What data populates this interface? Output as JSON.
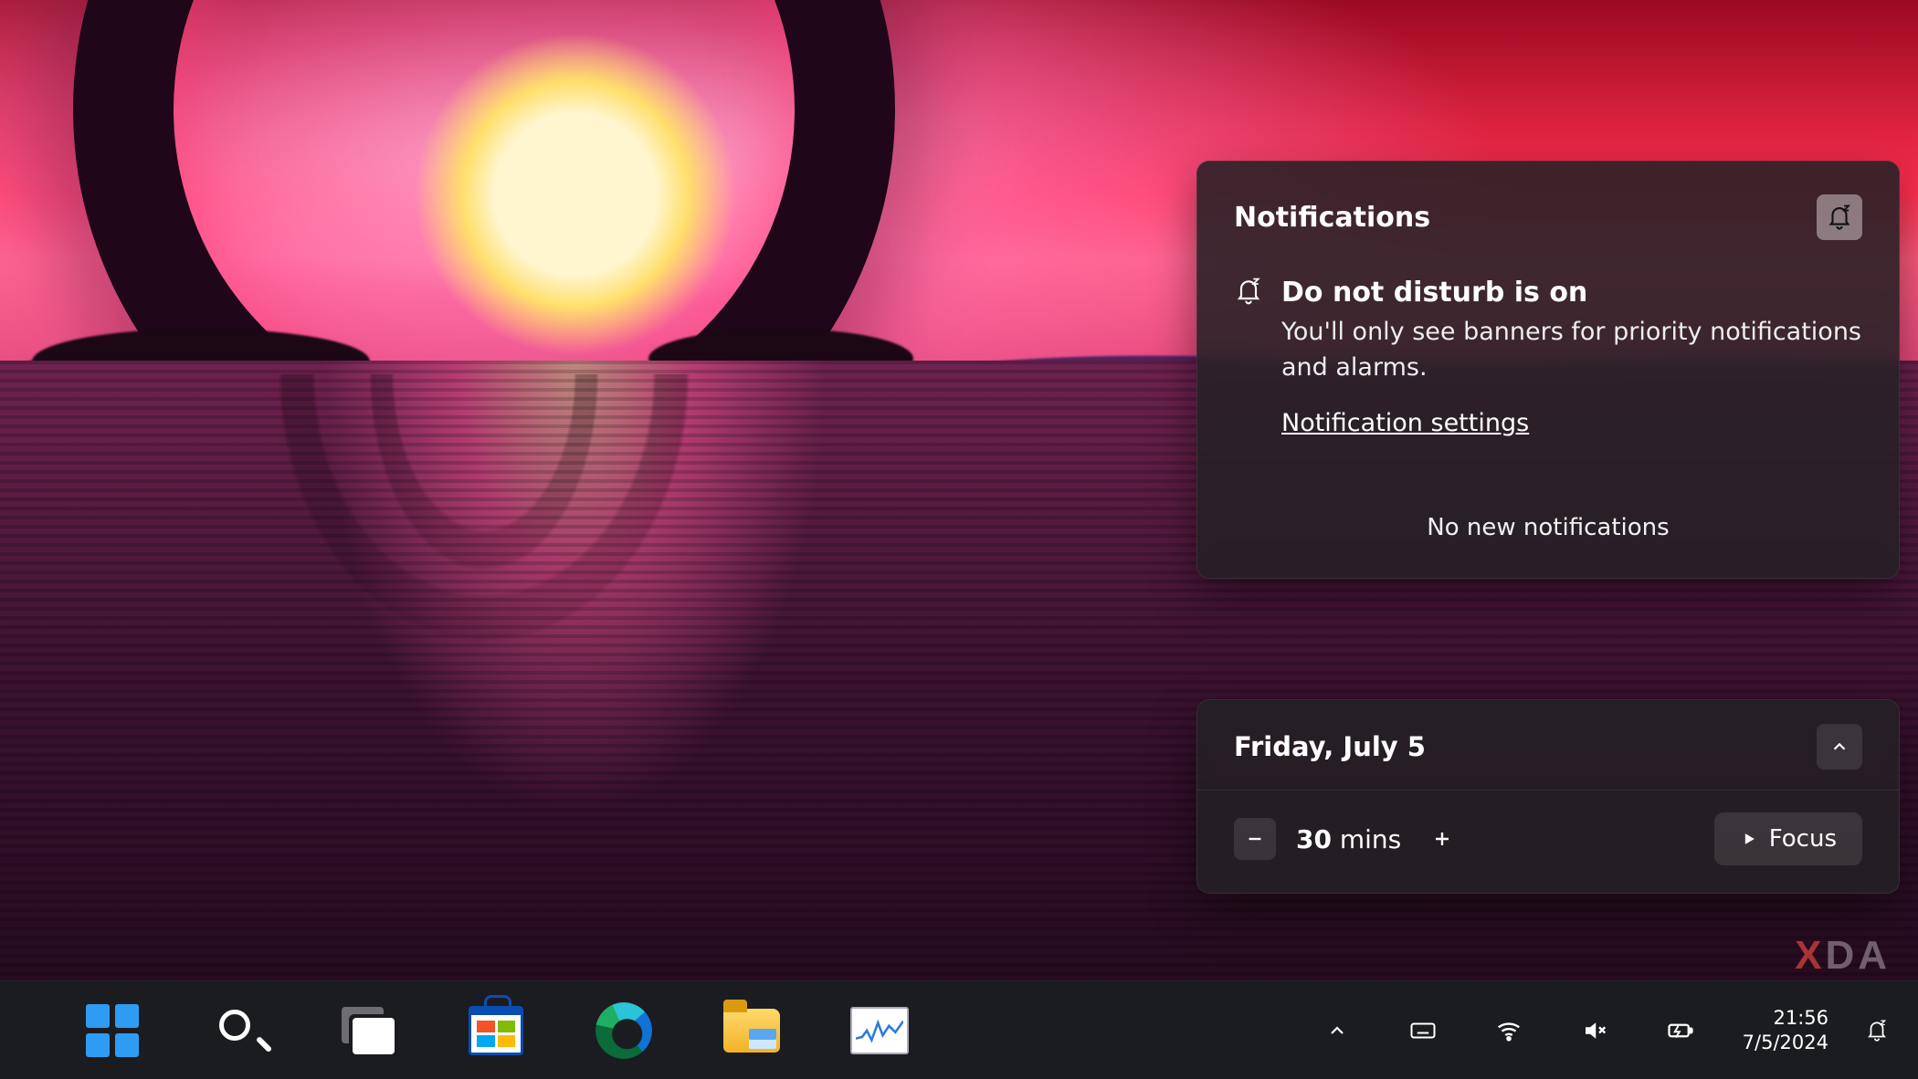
{
  "notifications": {
    "title": "Notifications",
    "dnd_title": "Do not disturb is on",
    "dnd_description": "You'll only see banners for priority notifications and alarms.",
    "settings_link": "Notification settings",
    "empty_message": "No new notifications"
  },
  "calendar": {
    "date_label": "Friday, July 5",
    "focus_duration_value": "30",
    "focus_duration_unit": "mins",
    "focus_button": "Focus"
  },
  "taskbar": {
    "time": "21:56",
    "date": "7/5/2024"
  },
  "watermark": {
    "prefix": "X",
    "suffix": "DA"
  }
}
